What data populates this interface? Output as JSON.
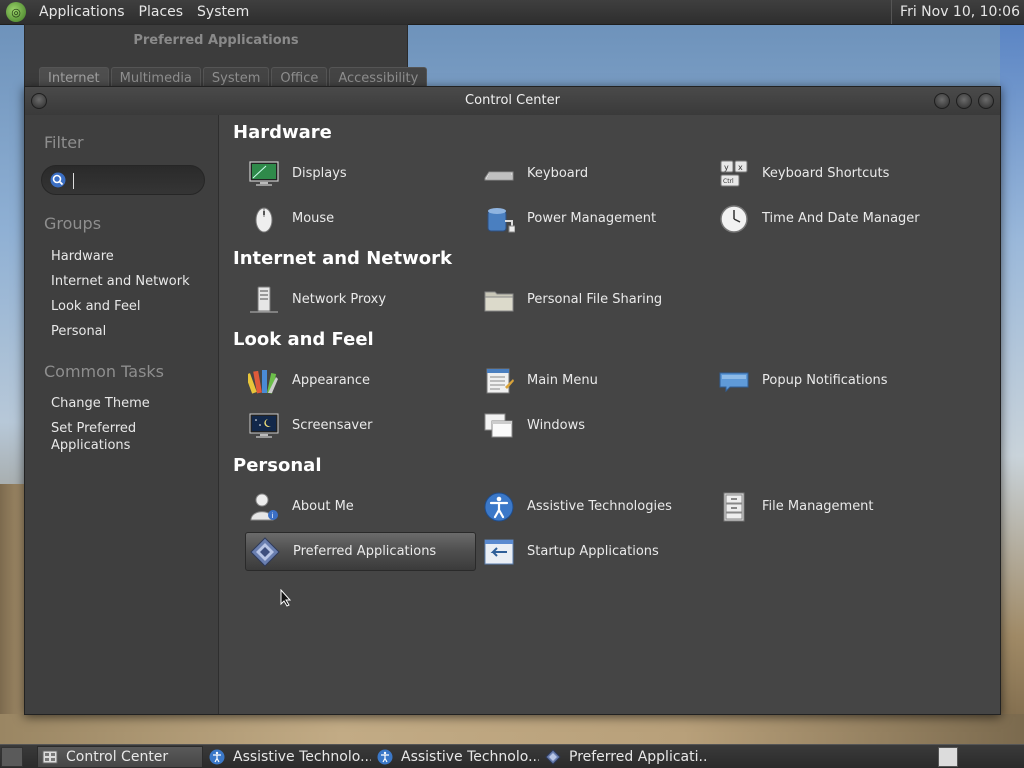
{
  "top_panel": {
    "menus": [
      "Applications",
      "Places",
      "System"
    ],
    "clock": "Fri Nov 10, 10:06"
  },
  "background_window": {
    "title": "Preferred Applications",
    "tabs": [
      "Internet",
      "Multimedia",
      "System",
      "Office",
      "Accessibility"
    ]
  },
  "window": {
    "title": "Control Center"
  },
  "sidebar": {
    "filter_heading": "Filter",
    "search_value": "",
    "groups_heading": "Groups",
    "groups": [
      "Hardware",
      "Internet and Network",
      "Look and Feel",
      "Personal"
    ],
    "tasks_heading": "Common Tasks",
    "tasks": [
      "Change Theme",
      "Set Preferred Applications"
    ]
  },
  "sections": [
    {
      "title": "Hardware",
      "items": [
        {
          "label": "Displays",
          "icon": "display-icon"
        },
        {
          "label": "Keyboard",
          "icon": "keyboard-icon"
        },
        {
          "label": "Keyboard Shortcuts",
          "icon": "keyboard-shortcuts-icon"
        },
        {
          "label": "Mouse",
          "icon": "mouse-icon"
        },
        {
          "label": "Power Management",
          "icon": "power-icon"
        },
        {
          "label": "Time And Date Manager",
          "icon": "clock-icon"
        }
      ]
    },
    {
      "title": "Internet and Network",
      "items": [
        {
          "label": "Network Proxy",
          "icon": "network-proxy-icon"
        },
        {
          "label": "Personal File Sharing",
          "icon": "folder-share-icon"
        }
      ]
    },
    {
      "title": "Look and Feel",
      "items": [
        {
          "label": "Appearance",
          "icon": "appearance-icon"
        },
        {
          "label": "Main Menu",
          "icon": "main-menu-icon"
        },
        {
          "label": "Popup Notifications",
          "icon": "notification-icon"
        },
        {
          "label": "Screensaver",
          "icon": "screensaver-icon"
        },
        {
          "label": "Windows",
          "icon": "windows-icon"
        }
      ]
    },
    {
      "title": "Personal",
      "items": [
        {
          "label": "About Me",
          "icon": "about-me-icon"
        },
        {
          "label": "Assistive Technologies",
          "icon": "accessibility-icon"
        },
        {
          "label": "File Management",
          "icon": "file-cabinet-icon"
        },
        {
          "label": "Preferred Applications",
          "icon": "preferred-apps-icon",
          "selected": true
        },
        {
          "label": "Startup Applications",
          "icon": "startup-icon"
        }
      ]
    }
  ],
  "taskbar": {
    "tasks": [
      {
        "label": "Control Center",
        "icon": "control-center-icon",
        "active": true
      },
      {
        "label": "Assistive Technolo...",
        "icon": "accessibility-icon",
        "active": false
      },
      {
        "label": "Assistive Technolo...",
        "icon": "accessibility-icon",
        "active": false
      },
      {
        "label": "Preferred Applicati...",
        "icon": "preferred-apps-icon",
        "active": false
      }
    ]
  }
}
